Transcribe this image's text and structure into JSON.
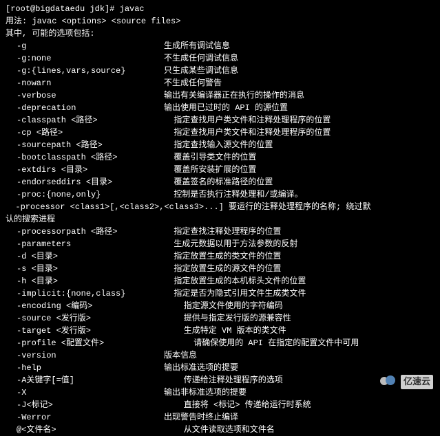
{
  "prompt": "[root@bigdataedu jdk]# javac",
  "usage": "用法: javac <options> <source files>",
  "intro": "其中, 可能的选项包括:",
  "options": [
    {
      "flag": "-g",
      "desc": "生成所有调试信息"
    },
    {
      "flag": "-g:none",
      "desc": "不生成任何调试信息"
    },
    {
      "flag": "-g:{lines,vars,source}",
      "desc": "只生成某些调试信息"
    },
    {
      "flag": "-nowarn",
      "desc": "不生成任何警告"
    },
    {
      "flag": "-verbose",
      "desc": "输出有关编译器正在执行的操作的消息"
    },
    {
      "flag": "-deprecation",
      "desc": "输出使用已过时的 API 的源位置"
    },
    {
      "flag": "-classpath <路径>",
      "desc": "  指定查找用户类文件和注释处理程序的位置"
    },
    {
      "flag": "-cp <路径>",
      "desc": "  指定查找用户类文件和注释处理程序的位置"
    },
    {
      "flag": "-sourcepath <路径>",
      "desc": "  指定查找输入源文件的位置"
    },
    {
      "flag": "-bootclasspath <路径>",
      "desc": "  覆盖引导类文件的位置"
    },
    {
      "flag": "-extdirs <目录>",
      "desc": "  覆盖所安装扩展的位置"
    },
    {
      "flag": "-endorseddirs <目录>",
      "desc": "  覆盖签名的标准路径的位置"
    },
    {
      "flag": "-proc:{none,only}",
      "desc": "  控制是否执行注释处理和/或编译。"
    }
  ],
  "processor_line": "  -processor <class1>[,<class2>,<class3>...] 要运行的注释处理程序的名称; 绕过默",
  "processor_cont": "认的搜索进程",
  "options2": [
    {
      "flag": "-processorpath <路径>",
      "desc": "  指定查找注释处理程序的位置"
    },
    {
      "flag": "-parameters",
      "desc": "  生成元数据以用于方法参数的反射"
    },
    {
      "flag": "-d <目录>",
      "desc": "  指定放置生成的类文件的位置"
    },
    {
      "flag": "-s <目录>",
      "desc": "  指定放置生成的源文件的位置"
    },
    {
      "flag": "-h <目录>",
      "desc": "  指定放置生成的本机标头文件的位置"
    },
    {
      "flag": "-implicit:{none,class}",
      "desc": "  指定是否为隐式引用文件生成类文件"
    },
    {
      "flag": "-encoding <编码>",
      "desc": "    指定源文件使用的字符编码"
    },
    {
      "flag": "-source <发行版>",
      "desc": "    提供与指定发行版的源兼容性"
    },
    {
      "flag": "-target <发行版>",
      "desc": "    生成特定 VM 版本的类文件"
    },
    {
      "flag": "-profile <配置文件>",
      "desc": "      请确保使用的 API 在指定的配置文件中可用"
    },
    {
      "flag": "-version",
      "desc": "版本信息"
    },
    {
      "flag": "-help",
      "desc": "输出标准选项的提要"
    },
    {
      "flag": "-A关键字[=值]",
      "desc": "    传递给注释处理程序的选项"
    },
    {
      "flag": "-X",
      "desc": "输出非标准选项的提要"
    },
    {
      "flag": "-J<标记>",
      "desc": "    直接将 <标记> 传递给运行时系统"
    },
    {
      "flag": "-Werror",
      "desc": "出现警告时终止编译"
    },
    {
      "flag": "@<文件名>",
      "desc": "    从文件读取选项和文件名"
    }
  ],
  "watermark": "亿速云"
}
